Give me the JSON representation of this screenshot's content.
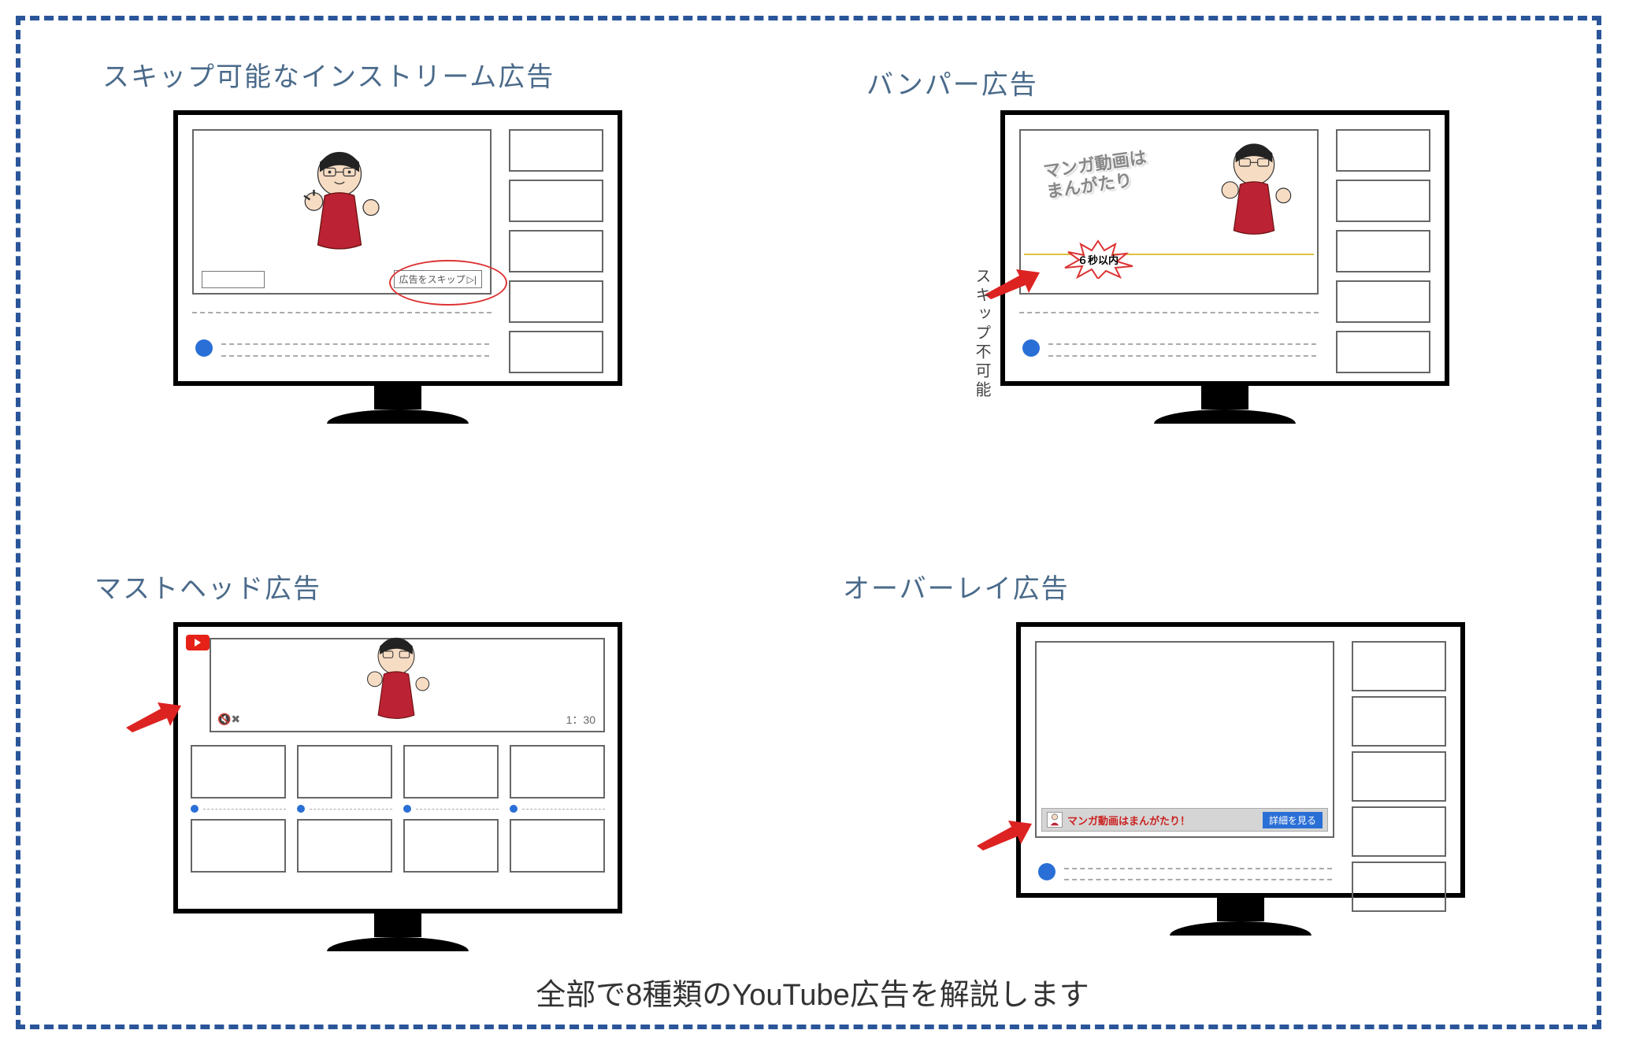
{
  "titles": {
    "instream": "スキップ可能なインストリーム広告",
    "bumper": "バンパー広告",
    "masthead": "マストヘッド広告",
    "overlay": "オーバーレイ広告"
  },
  "caption": "全部で8種類のYouTube広告を解説します",
  "instream": {
    "skip_label": "広告をスキップ"
  },
  "bumper": {
    "promo_line1": "マンガ動画は",
    "promo_line2": "まんがたり",
    "burst_label": "６秒以内",
    "side_note": "スキップ不可能"
  },
  "masthead": {
    "mute_glyph": "🔇✖",
    "duration": "1：30"
  },
  "overlay": {
    "banner_text": "マンガ動画はまんがたり！",
    "cta_label": "詳細を見る"
  }
}
